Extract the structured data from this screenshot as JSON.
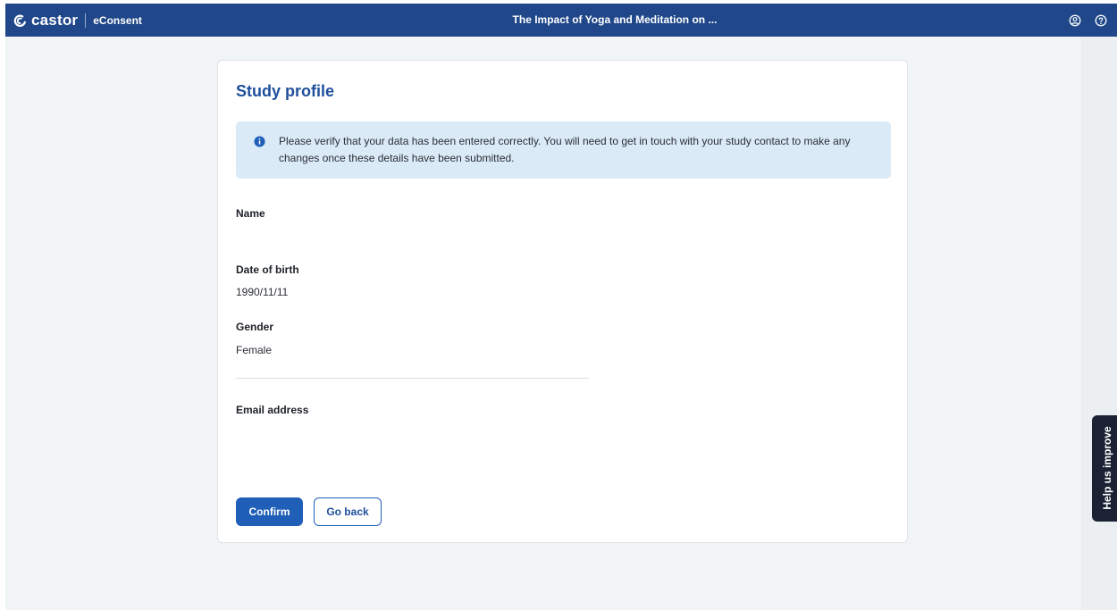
{
  "app": {
    "logo_text": "castor",
    "product_name": "eConsent",
    "study_title": "The Impact of Yoga and Meditation on ..."
  },
  "header_icons": [
    "account-icon",
    "help-icon"
  ],
  "profile": {
    "title": "Study profile",
    "notice": "Please verify that your data has been entered correctly. You will need to get in touch with your study contact to make any changes once these details have been submitted.",
    "fields": [
      {
        "label": "Name",
        "value": ""
      },
      {
        "label": "Date of birth",
        "value": "1990/11/11"
      },
      {
        "label": "Gender",
        "value": "Female"
      },
      {
        "label": "Email address",
        "value": ""
      }
    ]
  },
  "actions": {
    "confirm_label": "Confirm",
    "back_label": "Go back"
  },
  "feedback": {
    "label": "Help us improve"
  },
  "colors": {
    "header_bg": "#1f4789",
    "accent": "#1f5fb8",
    "title": "#1f4f9c",
    "info_bg": "#daeaf7",
    "feedback_bg": "#1a2233"
  }
}
